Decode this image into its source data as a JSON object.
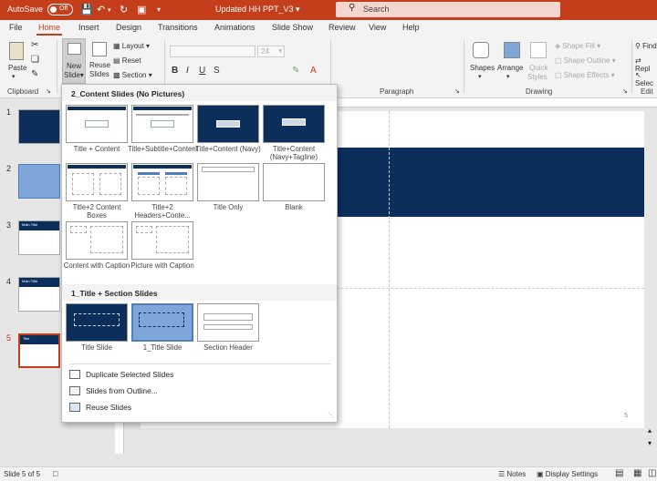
{
  "titlebar": {
    "autosave_label": "AutoSave",
    "autosave_state": "Off",
    "doc_title": "Updated HH PPT_V3",
    "search_placeholder": "Search"
  },
  "tabs": [
    {
      "label": "File"
    },
    {
      "label": "Home"
    },
    {
      "label": "Insert"
    },
    {
      "label": "Design"
    },
    {
      "label": "Transitions"
    },
    {
      "label": "Animations"
    },
    {
      "label": "Slide Show"
    },
    {
      "label": "Review"
    },
    {
      "label": "View"
    },
    {
      "label": "Help"
    }
  ],
  "ribbon": {
    "paste_label": "Paste",
    "clipboard_label": "Clipboard",
    "new_slide_label_1": "New",
    "new_slide_label_2": "Slide",
    "reuse_label_1": "Reuse",
    "reuse_label_2": "Slides",
    "layout_label": "Layout",
    "reset_label": "Reset",
    "section_label": "Section",
    "font_size": "24",
    "paragraph_label": "Paragraph",
    "shapes_label": "Shapes",
    "arrange_label": "Arrange",
    "quick_styles_1": "Quick",
    "quick_styles_2": "Styles",
    "shape_fill": "Shape Fill",
    "shape_outline": "Shape Outline",
    "shape_effects": "Shape Effects",
    "drawing_label": "Drawing",
    "find_label": "Find",
    "replace_label": "Repl",
    "select_label": "Selec",
    "editing_label": "Edit"
  },
  "thumbnails": [
    {
      "num": "1"
    },
    {
      "num": "2"
    },
    {
      "num": "3",
      "title": "Main Title"
    },
    {
      "num": "4",
      "title": "Main Title"
    },
    {
      "num": "5",
      "title": "Title"
    }
  ],
  "slide": {
    "page_number": "5"
  },
  "dropdown": {
    "section1_title": "2_Content Slides (No Pictures)",
    "section1_layouts": [
      "Title + Content",
      "Title+Subtitle+Content",
      "Title+Content (Navy)",
      "Title+Content (Navy+Tagline)",
      "Title+2 Content Boxes",
      "Title+2 Headers+Conte...",
      "Title Only",
      "Blank",
      "Content with Caption",
      "Picture with Caption"
    ],
    "section2_title": "1_Title + Section Slides",
    "section2_layouts": [
      "Title Slide",
      "1_Title Slide",
      "Section Header"
    ],
    "actions": [
      "Duplicate Selected Slides",
      "Slides from Outline...",
      "Reuse Slides"
    ]
  },
  "statusbar": {
    "slide_count": "Slide 5 of 5",
    "notes": "Notes",
    "display_settings": "Display Settings"
  },
  "colors": {
    "accent": "#c43e1c",
    "navy": "#0b2f5a",
    "selected": "#7fa6d8"
  }
}
